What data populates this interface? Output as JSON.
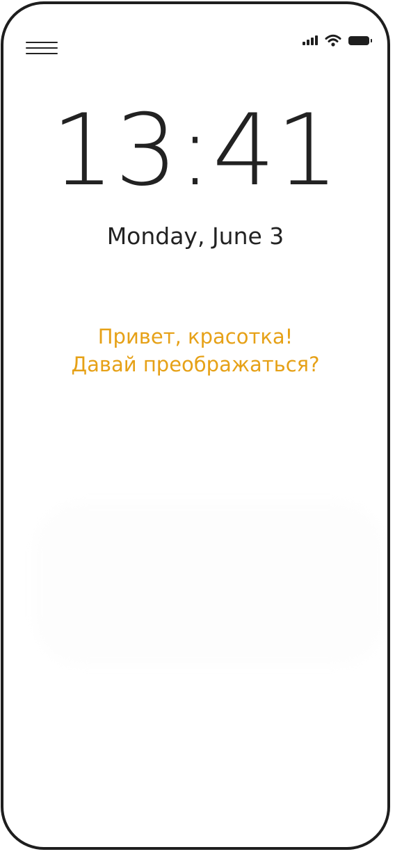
{
  "status_bar": {
    "icons": [
      "menu-icon",
      "signal-icon",
      "wifi-icon",
      "battery-icon"
    ]
  },
  "lock_screen": {
    "time": "13:41",
    "date": "Monday, June 3"
  },
  "greeting": {
    "line1": "Привет, красотка!",
    "line2": "Давай преображаться?",
    "color": "#e6a117"
  },
  "colors": {
    "frame": "#1e1e1e",
    "text": "#222222",
    "background": "#ffffff"
  }
}
